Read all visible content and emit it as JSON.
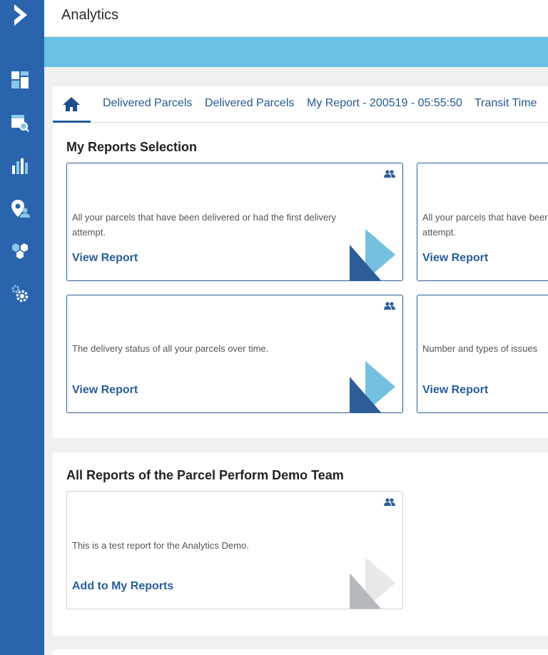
{
  "header": {
    "title": "Analytics"
  },
  "sidebar": {
    "logo": "logo-mark",
    "items": [
      {
        "icon": "dashboard-icon"
      },
      {
        "icon": "report-search-icon"
      },
      {
        "icon": "bar-chart-icon"
      },
      {
        "icon": "location-user-icon"
      },
      {
        "icon": "hexagons-icon"
      },
      {
        "icon": "settings-gears-icon"
      }
    ]
  },
  "tabs": {
    "home_icon": "home-icon",
    "items": [
      {
        "label": "Delivered Parcels"
      },
      {
        "label": "Delivered Parcels"
      },
      {
        "label": "My Report - 200519 - 05:55:50"
      },
      {
        "label": "Transit Time"
      }
    ]
  },
  "my_reports": {
    "title": "My Reports Selection",
    "cards": [
      {
        "description": "All your parcels that have been delivered or had the first delivery attempt.",
        "link": "View Report"
      },
      {
        "description": "All your parcels that have been delivered or had the first delivery attempt.",
        "link": "View Report"
      },
      {
        "description": "The delivery status of all your parcels over time.",
        "link": "View Report"
      },
      {
        "description": "Number and types of issues",
        "link": "View Report"
      }
    ]
  },
  "team_reports": {
    "title": "All Reports of the Parcel Perform Demo Team",
    "cards": [
      {
        "description": "This is a test report for the Analytics Demo.",
        "link": "Add to My Reports"
      }
    ]
  },
  "colors": {
    "sidebar": "#2a64ad",
    "banner": "#68c0e2",
    "accent": "#275e9c",
    "deco_dark": "#2b5e98",
    "deco_light": "#75bfe0"
  }
}
